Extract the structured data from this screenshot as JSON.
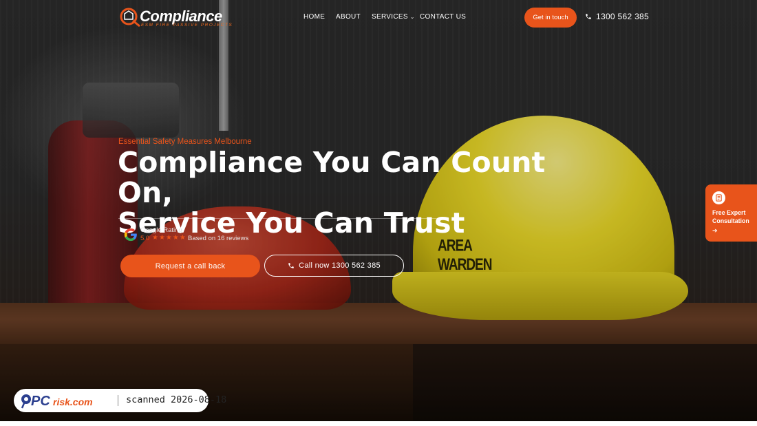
{
  "brand": {
    "name": "Compliance",
    "tagline": "ESM FIRE PASSIVE PROJECTS",
    "accent_color": "#e8541b"
  },
  "nav": {
    "items": [
      {
        "label": "HOME"
      },
      {
        "label": "ABOUT"
      },
      {
        "label": "SERVICES",
        "has_dropdown": true
      },
      {
        "label": "CONTACT US"
      }
    ]
  },
  "header": {
    "cta_label": "Get in touch",
    "phone": "1300 562 385",
    "phone_icon": "phone-icon"
  },
  "hero": {
    "eyebrow": "Essential Safety Measures Melbourne",
    "headline_line1": "Compliance You Can Count On,",
    "headline_line2": "Service You Can Trust",
    "helmet_text": "AREA WARDEN",
    "rating": {
      "label": "Google Rating",
      "score": "5.0",
      "stars": 5,
      "reviews": "Based on 16 reviews",
      "icon": "google-g-icon"
    },
    "primary_button": "Request a call back",
    "secondary_button": "Call now 1300 562 385"
  },
  "side_tab": {
    "label": "Free Expert Consultation",
    "icon": "document-icon",
    "arrow_icon": "arrow-right-icon"
  },
  "watermark": {
    "logo_text": "PCrisk.com",
    "scan_text": "scanned 2026-08-18"
  }
}
